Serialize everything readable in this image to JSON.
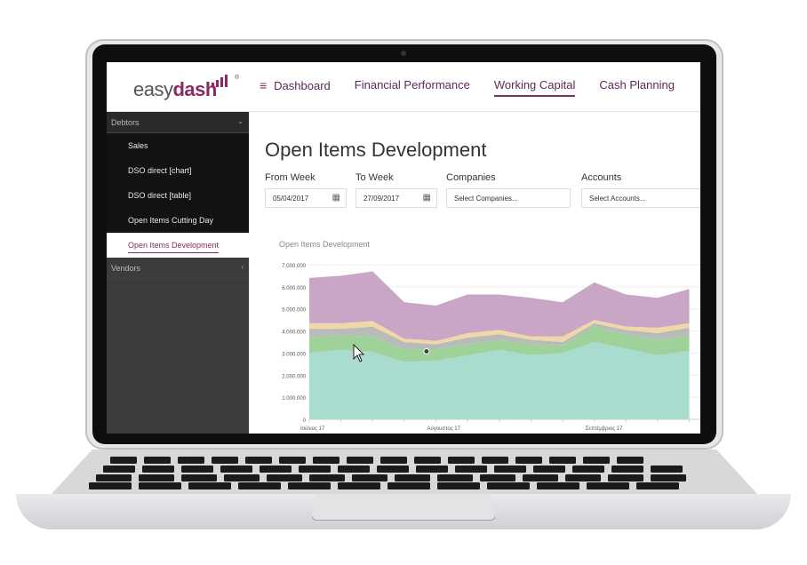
{
  "brand": {
    "name_part1": "easy",
    "name_part2": "dash",
    "accent": "#8a2a63"
  },
  "nav": {
    "menu_icon": "hamburger-icon",
    "items": [
      {
        "label": "Dashboard",
        "active": false
      },
      {
        "label": "Financial Performance",
        "active": false
      },
      {
        "label": "Working Capital",
        "active": true
      },
      {
        "label": "Cash Planning",
        "active": false
      }
    ]
  },
  "sidebar": {
    "debtors_header": "Debtors",
    "debtors_items": [
      {
        "label": "Sales"
      },
      {
        "label": "DSO direct [chart]"
      },
      {
        "label": "DSO direct [table]"
      },
      {
        "label": "Open Items Cutting Day"
      },
      {
        "label": "Open Items Development",
        "active": true
      }
    ],
    "vendors_header": "Vendors"
  },
  "main": {
    "title": "Open Items Development",
    "filters": {
      "from_week_label": "From Week",
      "from_week_value": "05/04/2017",
      "to_week_label": "To Week",
      "to_week_value": "27/09/2017",
      "companies_label": "Companies",
      "companies_placeholder": "Select Companies...",
      "accounts_label": "Accounts",
      "accounts_placeholder": "Select Accounts..."
    }
  },
  "chart_data": {
    "type": "area",
    "title": "Open Items Development",
    "stacked": true,
    "ylim": [
      0,
      7000000
    ],
    "yticks": [
      "7.000.000",
      "6.000.000",
      "5.000.000",
      "4.000.000",
      "3.000.000",
      "2.000.000",
      "1.000.000",
      "0"
    ],
    "xtick_labels": [
      "Ιούλιος 17",
      "Αύγουστος 17",
      "Σεπτέμβριος 17"
    ],
    "x": [
      "1",
      "2",
      "3",
      "4",
      "5",
      "6",
      "7",
      "8",
      "9",
      "10",
      "11",
      "12",
      "13"
    ],
    "series": [
      {
        "color": "#a8dccf",
        "values": [
          3000000,
          3150000,
          3050000,
          2600000,
          2650000,
          2900000,
          3150000,
          2900000,
          3000000,
          3500000,
          3200000,
          2900000,
          3100000
        ]
      },
      {
        "color": "#9ed29a",
        "values": [
          700000,
          650000,
          700000,
          600000,
          550000,
          500000,
          450000,
          500000,
          350000,
          700000,
          650000,
          700000,
          700000
        ]
      },
      {
        "color": "#b8bbb8",
        "values": [
          400000,
          300000,
          450000,
          300000,
          200000,
          300000,
          250000,
          200000,
          150000,
          150000,
          200000,
          300000,
          350000
        ]
      },
      {
        "color": "#f1d7a8",
        "values": [
          250000,
          250000,
          250000,
          150000,
          150000,
          200000,
          200000,
          150000,
          250000,
          150000,
          150000,
          250000,
          200000
        ]
      },
      {
        "color": "#c9a6c5",
        "values": [
          2050000,
          2150000,
          2250000,
          1650000,
          1600000,
          1750000,
          1600000,
          1750000,
          1550000,
          1700000,
          1450000,
          1350000,
          1550000
        ]
      }
    ]
  }
}
